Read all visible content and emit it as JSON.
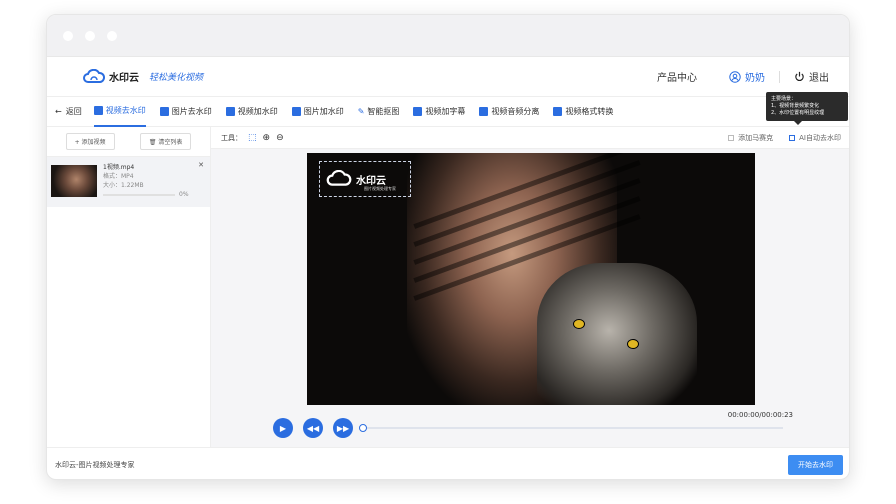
{
  "brand": {
    "logo_text": "水印云",
    "logo_sub": "图片视频处理专家",
    "slogan": "轻松美化视频"
  },
  "header": {
    "product_center": "产品中心",
    "user_name": "奶奶",
    "logout": "退出"
  },
  "toolbar": {
    "back": "返回",
    "items": [
      {
        "label": "视频去水印",
        "active": true
      },
      {
        "label": "图片去水印"
      },
      {
        "label": "视频加水印"
      },
      {
        "label": "图片加水印"
      },
      {
        "label": "智能抠图"
      },
      {
        "label": "视频加字幕"
      },
      {
        "label": "视频音频分离"
      },
      {
        "label": "视频格式转换"
      }
    ]
  },
  "tooltip": {
    "title": "主要场景：",
    "line1": "1、视频背景频繁变化",
    "line2": "2、水印位置有明显纹理"
  },
  "sidebar": {
    "add_video": "+ 添加视频",
    "clear_list": "清空列表",
    "file": {
      "name": "1视频.mp4",
      "format": "格式：MP4",
      "size": "大小：1.22MB",
      "progress": "0%"
    }
  },
  "content_toolbar": {
    "tools_label": "工具：",
    "mosaic": "添加马赛克",
    "ai_remove": "AI自动去水印"
  },
  "player": {
    "time": "00:00:00/00:00:23",
    "progress": 0
  },
  "footer": {
    "app_label": "水印云-图片视频处理专家",
    "start_button": "开始去水印"
  },
  "colors": {
    "accent": "#2b6de0",
    "button": "#3d8df2"
  }
}
